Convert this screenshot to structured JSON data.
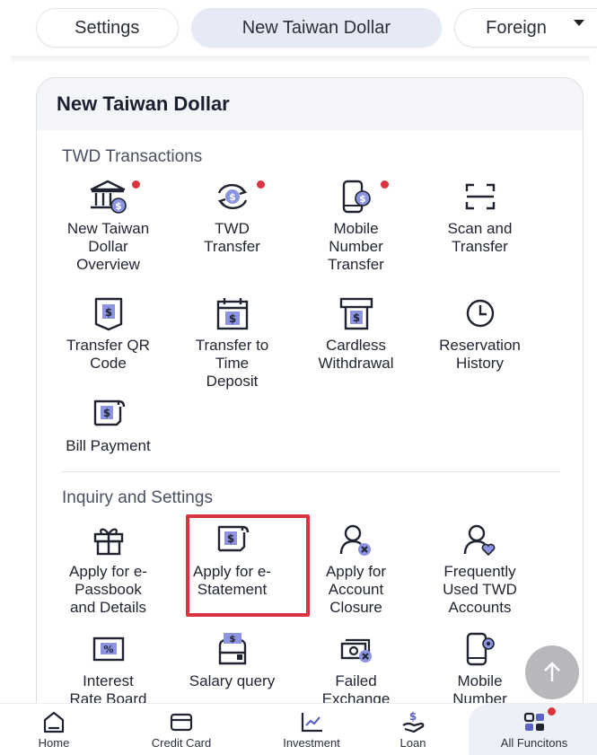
{
  "tabs": [
    {
      "label": "Settings"
    },
    {
      "label": "New Taiwan Dollar",
      "active": true
    },
    {
      "label": "Foreign"
    }
  ],
  "card": {
    "title": "New Taiwan Dollar",
    "sections": [
      {
        "title": "TWD Transactions",
        "items": [
          {
            "label_lines": [
              "New Taiwan",
              "Dollar",
              "Overview"
            ],
            "icon": "bank-icon",
            "badge": true
          },
          {
            "label_lines": [
              "TWD",
              "Transfer"
            ],
            "icon": "transfer-icon",
            "badge": true
          },
          {
            "label_lines": [
              "Mobile",
              "Number",
              "Transfer"
            ],
            "icon": "mobile-transfer-icon",
            "badge": true
          },
          {
            "label_lines": [
              "Scan and",
              "Transfer"
            ],
            "icon": "scan-icon",
            "badge": false
          },
          {
            "label_lines": [
              "Transfer QR",
              "Code"
            ],
            "icon": "qr-code-icon",
            "badge": false
          },
          {
            "label_lines": [
              "Transfer to",
              "Time",
              "Deposit"
            ],
            "icon": "calendar-deposit-icon",
            "badge": false
          },
          {
            "label_lines": [
              "Cardless",
              "Withdrawal"
            ],
            "icon": "atm-icon",
            "badge": false
          },
          {
            "label_lines": [
              "Reservation",
              "History"
            ],
            "icon": "clock-icon",
            "badge": false
          },
          {
            "label_lines": [
              "Bill Payment"
            ],
            "icon": "bill-icon",
            "badge": false
          }
        ]
      },
      {
        "title": "Inquiry and Settings",
        "items": [
          {
            "label_lines": [
              "Apply for e-",
              "Passbook",
              "and Details"
            ],
            "icon": "gift-icon"
          },
          {
            "label_lines": [
              "Apply for e-",
              "Statement"
            ],
            "icon": "statement-icon",
            "highlighted": true
          },
          {
            "label_lines": [
              "Apply for",
              "Account",
              "Closure"
            ],
            "icon": "user-close-icon"
          },
          {
            "label_lines": [
              "Frequently",
              "Used TWD",
              "Accounts"
            ],
            "icon": "user-heart-icon"
          },
          {
            "label_lines": [
              "Interest",
              "Rate Board"
            ],
            "icon": "percent-board-icon"
          },
          {
            "label_lines": [
              "Salary query"
            ],
            "icon": "salary-icon"
          },
          {
            "label_lines": [
              "Failed",
              "Exchange"
            ],
            "icon": "failed-exchange-icon"
          },
          {
            "label_lines": [
              "Mobile",
              "Number"
            ],
            "icon": "mobile-settings-icon"
          }
        ]
      }
    ]
  },
  "bottom_nav": [
    {
      "label": "Home",
      "icon": "home-icon"
    },
    {
      "label": "Credit Card",
      "icon": "credit-card-icon"
    },
    {
      "label": "Investment",
      "icon": "investment-icon"
    },
    {
      "label": "Loan",
      "icon": "loan-icon"
    },
    {
      "label": "All Funcitons",
      "icon": "all-functions-icon",
      "active": true,
      "badge": true
    }
  ],
  "colors": {
    "accent": "#5b63c7",
    "badge": "#d8333f",
    "highlight": "#d9333f",
    "active_tab_bg": "#e6e9f6"
  }
}
